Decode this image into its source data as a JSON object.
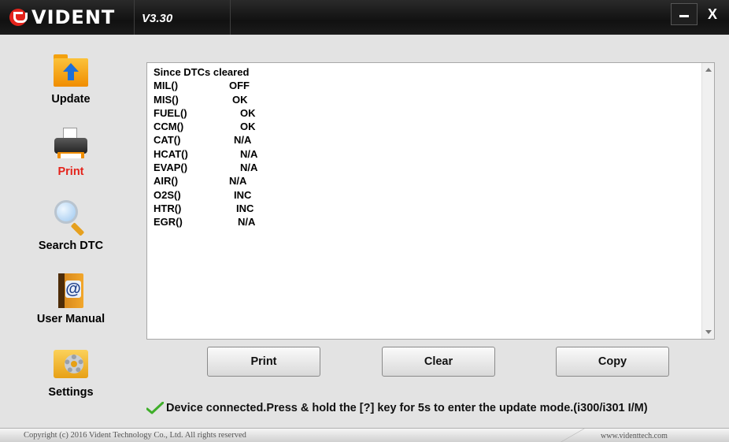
{
  "titlebar": {
    "logo_text": "VIDENT",
    "version": "V3.30",
    "minimize_icon": "minimize-icon",
    "close_label": "X"
  },
  "sidebar": {
    "items": [
      {
        "label": "Update",
        "icon": "folder-upload-icon",
        "active": false
      },
      {
        "label": "Print",
        "icon": "printer-icon",
        "active": true
      },
      {
        "label": "Search DTC",
        "icon": "magnifier-icon",
        "active": false
      },
      {
        "label": "User Manual",
        "icon": "address-book-icon",
        "active": false
      },
      {
        "label": "Settings",
        "icon": "gear-icon",
        "active": false
      }
    ]
  },
  "output": {
    "heading": "Since DTCs cleared",
    "rows": [
      {
        "key": "MIL()",
        "value": "OFF"
      },
      {
        "key": "MIS()",
        "value": "OK"
      },
      {
        "key": "FUEL()",
        "value": "OK"
      },
      {
        "key": "CCM()",
        "value": "OK"
      },
      {
        "key": "CAT()",
        "value": "N/A"
      },
      {
        "key": "HCAT()",
        "value": "N/A"
      },
      {
        "key": "EVAP()",
        "value": "N/A"
      },
      {
        "key": "AIR()",
        "value": "N/A"
      },
      {
        "key": "O2S()",
        "value": "INC"
      },
      {
        "key": "HTR()",
        "value": "INC"
      },
      {
        "key": "EGR()",
        "value": "N/A"
      }
    ]
  },
  "buttons": {
    "print": "Print",
    "clear": "Clear",
    "copy": "Copy"
  },
  "status": {
    "icon": "checkmark-icon",
    "text": "Device connected.Press & hold the [?] key for 5s to enter the update mode.(i300/i301 I/M)"
  },
  "footer": {
    "copyright": "Copyright (c) 2016 Vident Technology Co., Ltd. All rights reserved",
    "website": "www.videnttech.com"
  },
  "colors": {
    "brand_red": "#e4231b",
    "titlebar": "#111111",
    "background": "#e3e3e3"
  }
}
